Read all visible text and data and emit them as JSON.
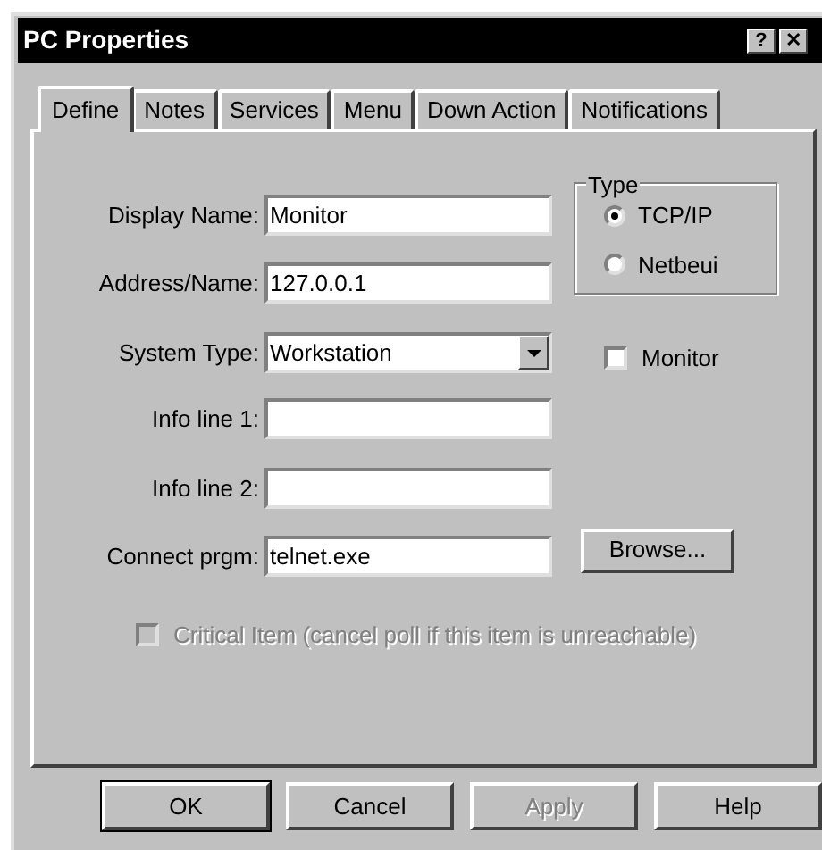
{
  "window": {
    "title": "PC Properties",
    "title_buttons": [
      "?",
      "✕"
    ]
  },
  "tabs": [
    {
      "label": "Define",
      "selected": true
    },
    {
      "label": "Notes",
      "selected": false
    },
    {
      "label": "Services",
      "selected": false
    },
    {
      "label": "Menu",
      "selected": false
    },
    {
      "label": "Down Action",
      "selected": false
    },
    {
      "label": "Notifications",
      "selected": false
    }
  ],
  "fields": [
    {
      "kind": "text",
      "label": "Display Name:",
      "value": "Monitor"
    },
    {
      "kind": "text",
      "label": "Address/Name:",
      "value": "127.0.0.1"
    },
    {
      "kind": "dropdown",
      "label": "System Type:",
      "value": "Workstation"
    },
    {
      "kind": "text",
      "label": "Info line 1:"
    },
    {
      "kind": "text",
      "label": "Info line 2:"
    },
    {
      "kind": "text",
      "label": "Connect prgm:",
      "value": "telnet.exe"
    }
  ],
  "type_group": {
    "title": "Type",
    "options": [
      {
        "label": "TCP/IP",
        "selected": true
      },
      {
        "label": "Netbeui",
        "selected": false
      }
    ]
  },
  "monitor_checkbox": {
    "label": "Monitor",
    "checked": false
  },
  "browse_button": "Browse...",
  "critical_checkbox": {
    "label": "Critical Item (cancel poll if this item is unreachable)",
    "checked": false,
    "disabled": true
  },
  "buttons": [
    {
      "label": "OK",
      "disabled": false,
      "default": true
    },
    {
      "label": "Cancel",
      "disabled": false,
      "default": false
    },
    {
      "label": "Apply",
      "disabled": true,
      "default": false
    },
    {
      "label": "Help",
      "disabled": false,
      "default": false
    }
  ]
}
